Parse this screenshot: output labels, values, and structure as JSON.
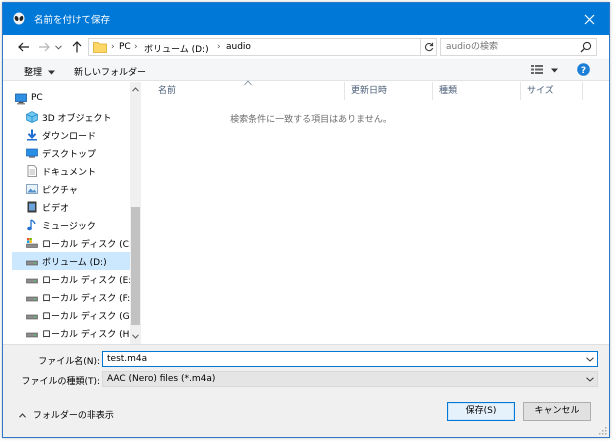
{
  "window": {
    "title": "名前を付けて保存"
  },
  "address": {
    "breadcrumbs": [
      "PC",
      "ボリューム (D:)",
      "audio"
    ],
    "separator": "›",
    "search_placeholder": "audioの検索"
  },
  "toolbar": {
    "organize": "整理",
    "new_folder": "新しいフォルダー"
  },
  "nav": {
    "items": [
      {
        "label": "PC",
        "icon": "pc-icon"
      },
      {
        "label": "3D オブジェクト",
        "icon": "3d-objects-icon"
      },
      {
        "label": "ダウンロード",
        "icon": "download-icon"
      },
      {
        "label": "デスクトップ",
        "icon": "desktop-icon"
      },
      {
        "label": "ドキュメント",
        "icon": "document-icon"
      },
      {
        "label": "ピクチャ",
        "icon": "pictures-icon"
      },
      {
        "label": "ビデオ",
        "icon": "video-icon"
      },
      {
        "label": "ミュージック",
        "icon": "music-icon"
      },
      {
        "label": "ローカル ディスク (C:)",
        "icon": "system-drive-icon"
      },
      {
        "label": "ボリューム (D:)",
        "icon": "drive-icon",
        "selected": true
      },
      {
        "label": "ローカル ディスク (E:)",
        "icon": "drive-icon"
      },
      {
        "label": "ローカル ディスク (F:)",
        "icon": "drive-icon"
      },
      {
        "label": "ローカル ディスク (G:)",
        "icon": "drive-icon"
      },
      {
        "label": "ローカル ディスク (H:)",
        "icon": "drive-icon"
      }
    ]
  },
  "files": {
    "columns": [
      "名前",
      "更新日時",
      "種類",
      "サイズ"
    ],
    "empty_message": "検索条件に一致する項目はありません。"
  },
  "form": {
    "filename_label": "ファイル名(N):",
    "filename_value": "test.m4a",
    "filetype_label": "ファイルの種類(T):",
    "filetype_value": "AAC (Nero) files (*.m4a)",
    "hide_folders": "フォルダーの非表示",
    "save": "保存(S)",
    "cancel": "キャンセル"
  },
  "colors": {
    "accent": "#0078d7",
    "selection": "#cce8ff",
    "help": "#1c7ed6"
  }
}
